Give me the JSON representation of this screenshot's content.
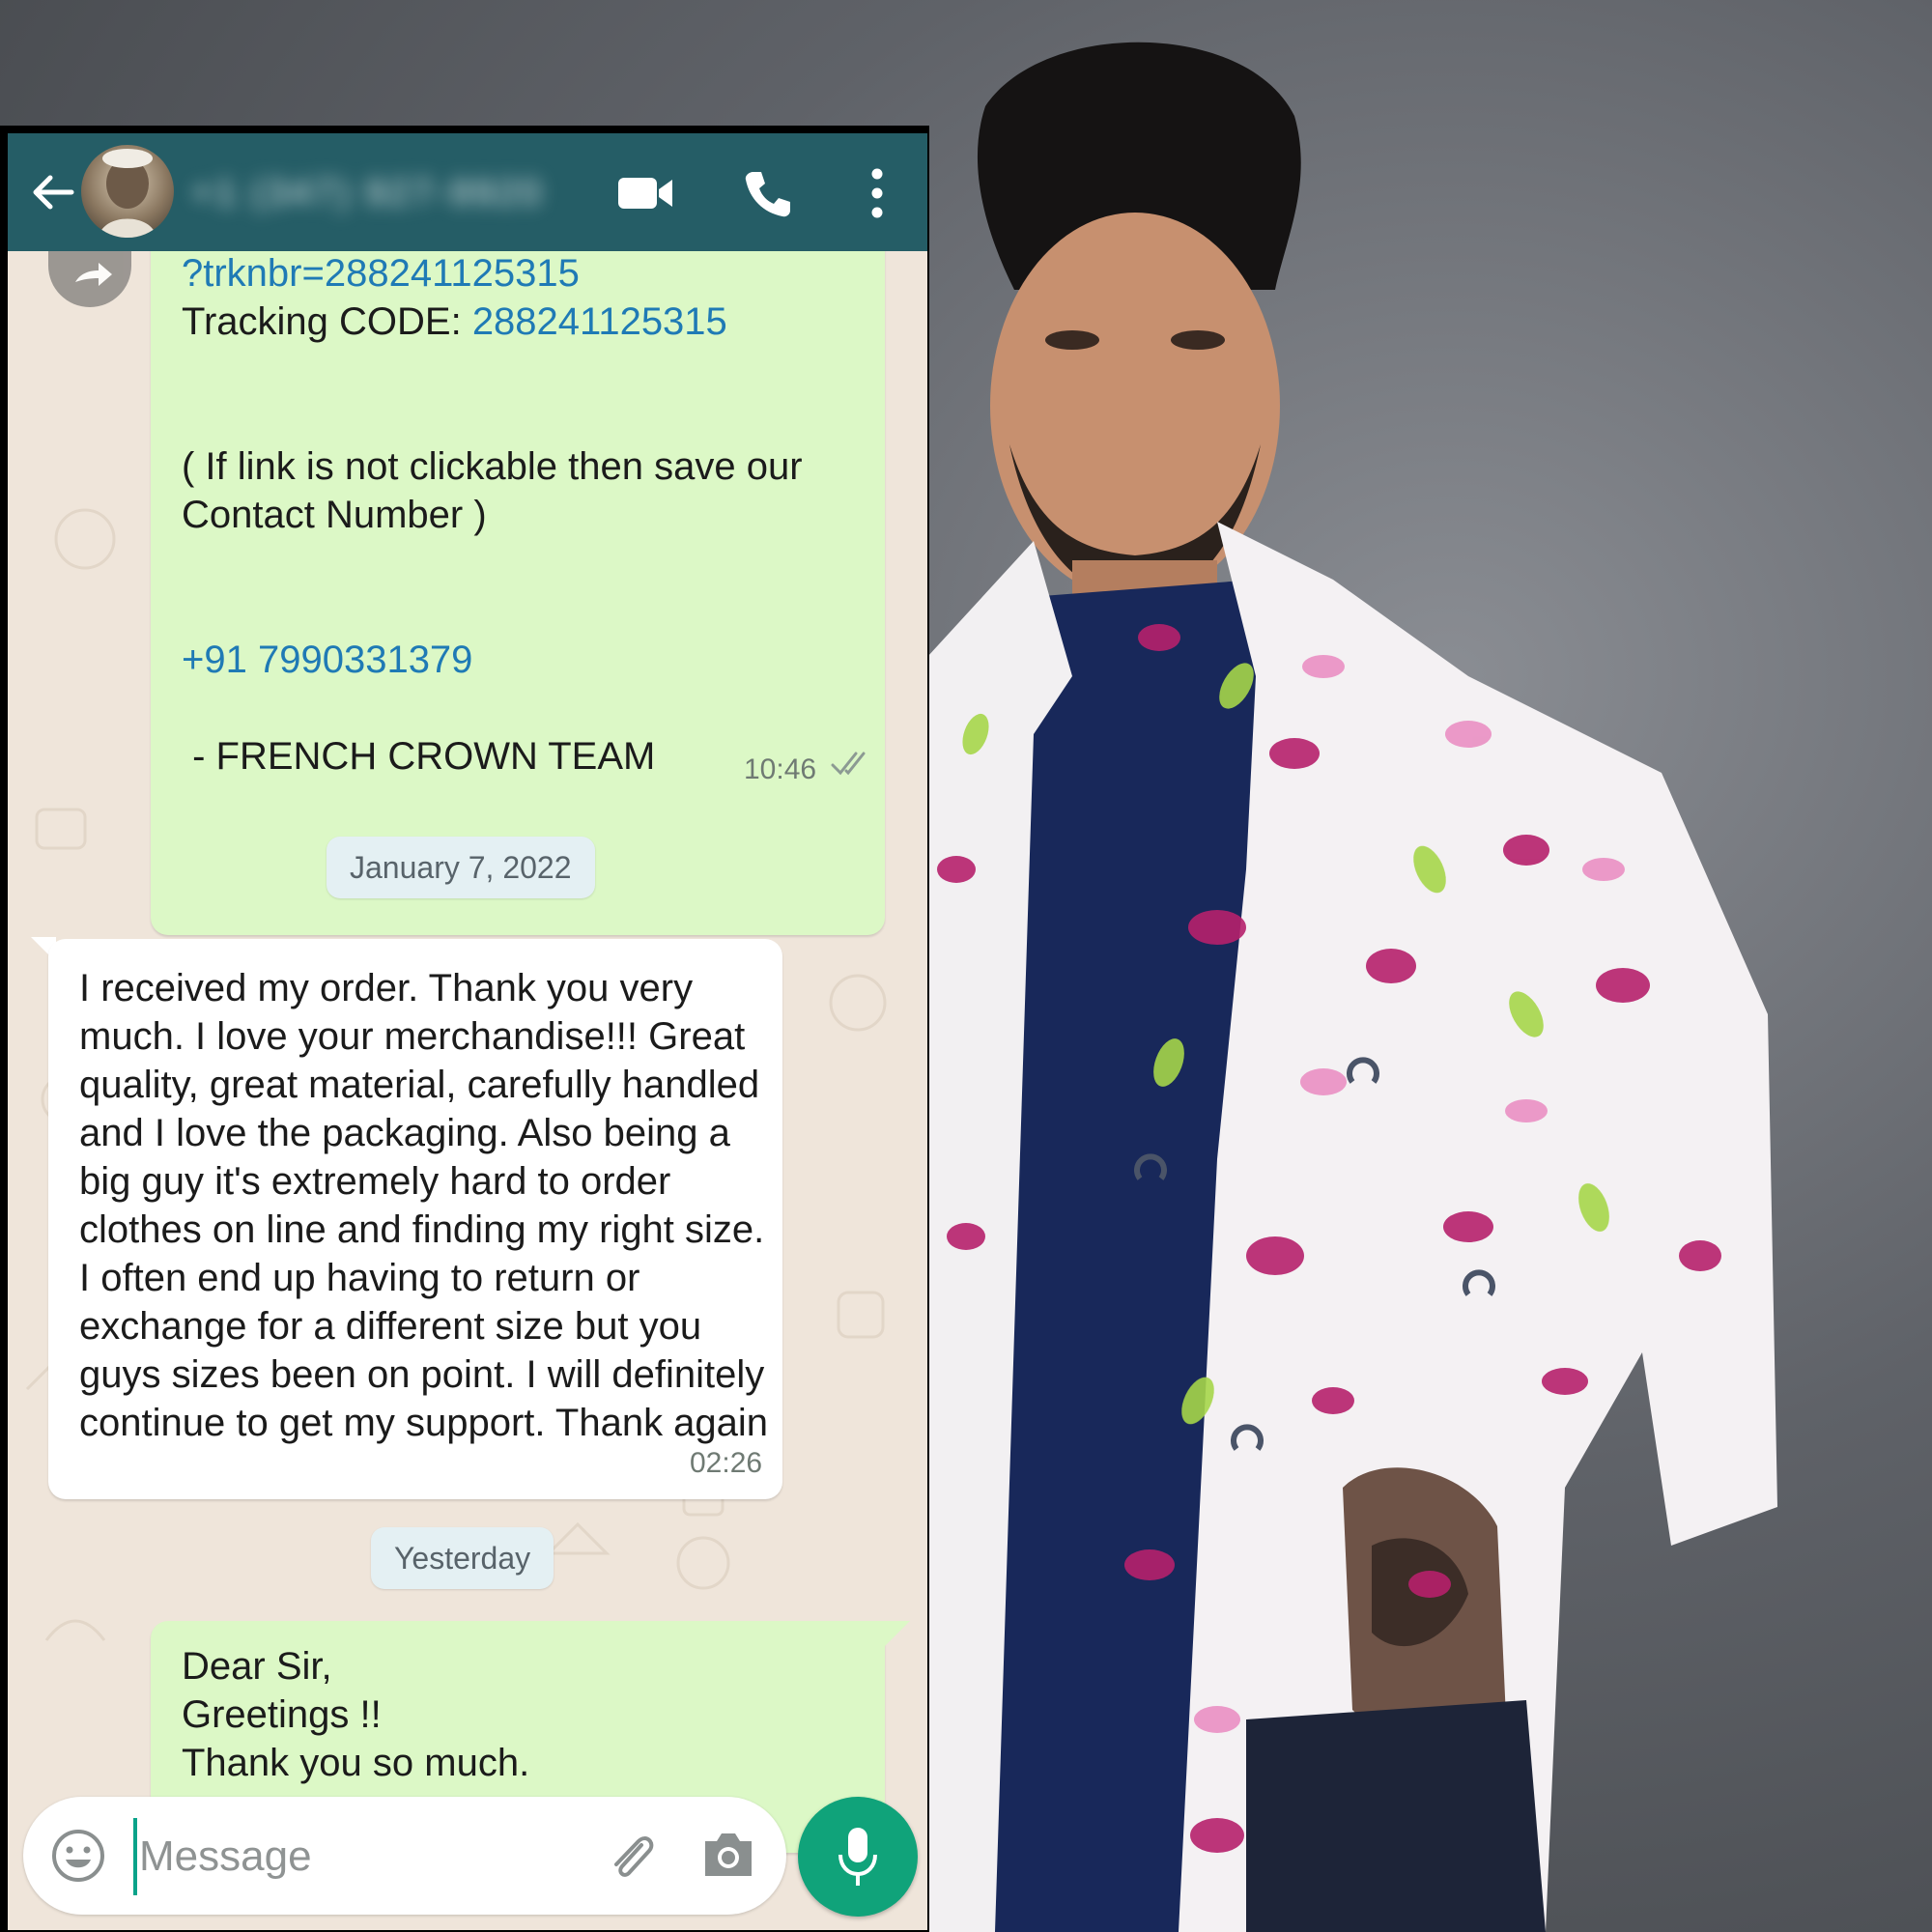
{
  "header": {
    "contact_name": "+1 (347) 927-9920",
    "icons": [
      "back-arrow-icon",
      "video-call-icon",
      "phone-call-icon",
      "more-vert-icon"
    ]
  },
  "messages": [
    {
      "direction": "outgoing",
      "lines": [
        {
          "text": "?trknbr=288241125315",
          "type": "link"
        },
        {
          "prefix": "Tracking CODE: ",
          "text": "288241125315",
          "type": "link"
        },
        {
          "text": "( If link is not clickable then save our"
        },
        {
          "text": "Contact Number )"
        },
        {
          "text": "+91 7990331379",
          "type": "link"
        },
        {
          "text": " - FRENCH CROWN TEAM"
        }
      ],
      "time": "10:46"
    },
    {
      "direction": "incoming",
      "text": "I received my order. Thank you very much. I love your merchandise!!! Great quality, great material, carefully handled and I love the packaging. Also being a big guy it's extremely hard to order clothes on line and finding my right size. I often end up having to return or exchange for a different size but you guys sizes been on point. I will definitely continue to get my support. Thank again",
      "time": "02:26"
    },
    {
      "direction": "outgoing",
      "lines": [
        {
          "text": "Dear Sir,"
        },
        {
          "text": "Greetings !!"
        },
        {
          "text": "Thank you so much."
        }
      ]
    }
  ],
  "date_separators": [
    "January 7, 2022",
    "Yesterday"
  ],
  "composer": {
    "placeholder": "Message"
  },
  "colors": {
    "header": "#255d66",
    "outgoing_bubble": "#dcf8c6",
    "incoming_bubble": "#ffffff",
    "link": "#1f7ab5",
    "mic_button": "#10a37a"
  }
}
